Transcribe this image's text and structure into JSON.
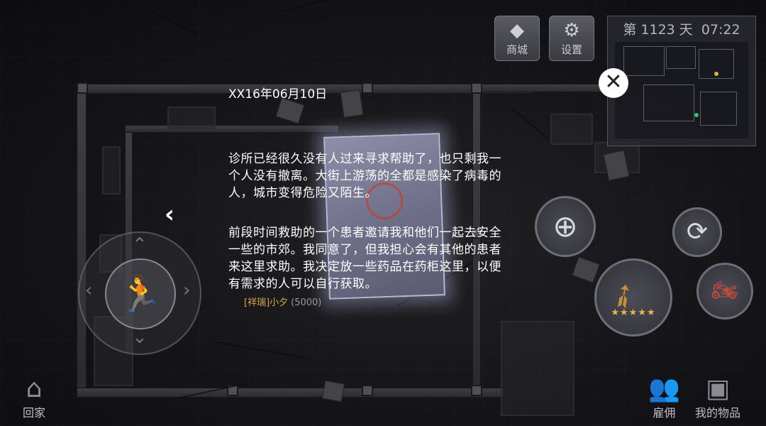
{
  "shop_button": {
    "label": "商城",
    "icon": "diamond-icon"
  },
  "settings_button": {
    "label": "设置",
    "icon": "gear-icon"
  },
  "day_info": {
    "prefix": "第",
    "day": "1123",
    "suffix": "天",
    "time": "07:22"
  },
  "close_button": {
    "icon": "close-icon",
    "glyph": "✕"
  },
  "diary": {
    "date": "XX16年06月10日",
    "paragraphs": [
      {
        "lines": [
          "诊所已经很久没有人过来寻求帮助了，也只剩我一",
          "个人没有撤离。大街上游荡的全都是感染了病毒的",
          "人，城市变得危险又陌生。"
        ]
      },
      {
        "lines": [
          "前段时间救助的一个患者邀请我和他们一起去安全",
          "一些的市郊。我同意了，但我担心会有其他的患者",
          "来这里求助。我决定放一些药品在药柜这里，以便",
          "有需求的人可以自行获取。"
        ]
      }
    ]
  },
  "back_arrow": {
    "glyph": "‹"
  },
  "character": {
    "name": "[祥瑞]小夕",
    "hp": "(5000)"
  },
  "weapon": {
    "stars": 5,
    "star_glyph": "★"
  },
  "bottom": {
    "home_label": "回家",
    "hire_label": "雇佣",
    "items_label": "我的物品"
  },
  "colors": {
    "accent_text": "#ffffff",
    "name_tag": "#d4a54a",
    "star": "#e8b64a"
  }
}
